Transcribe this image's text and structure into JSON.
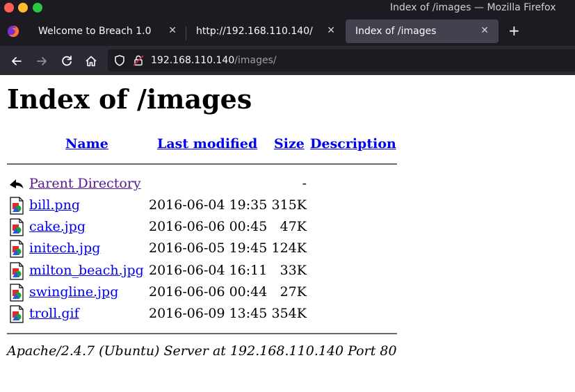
{
  "window": {
    "title": "Index of /images — Mozilla Firefox"
  },
  "tabs": [
    {
      "label": "Welcome to Breach 1.0",
      "close": "✕"
    },
    {
      "label": "http://192.168.110.140/",
      "close": "✕"
    },
    {
      "label": "Index of /images",
      "close": "✕",
      "active": true
    }
  ],
  "new_tab_label": "+",
  "url": {
    "host": "192.168.110.140",
    "path": "/images/"
  },
  "page": {
    "title": "Index of /images",
    "columns": {
      "name": "Name",
      "last_modified": "Last modified",
      "size": "Size",
      "description": "Description"
    },
    "parent": {
      "name": "Parent Directory",
      "size": "-"
    },
    "files": [
      {
        "name": "bill.png",
        "modified": "2016-06-04 19:35",
        "size": "315K"
      },
      {
        "name": "cake.jpg",
        "modified": "2016-06-06 00:45",
        "size": "47K"
      },
      {
        "name": "initech.jpg",
        "modified": "2016-06-05 19:45",
        "size": "124K"
      },
      {
        "name": "milton_beach.jpg",
        "modified": "2016-06-04 16:11",
        "size": "33K"
      },
      {
        "name": "swingline.jpg",
        "modified": "2016-06-06 00:44",
        "size": "27K"
      },
      {
        "name": "troll.gif",
        "modified": "2016-06-09 13:45",
        "size": "354K"
      }
    ],
    "address": "Apache/2.4.7 (Ubuntu) Server at 192.168.110.140 Port 80"
  },
  "colors": {
    "link": "#0000ee",
    "visited": "#551a8b",
    "chrome_dark": "#1c1b22",
    "toolbar": "#2b2a33",
    "active_tab": "#42414d"
  }
}
